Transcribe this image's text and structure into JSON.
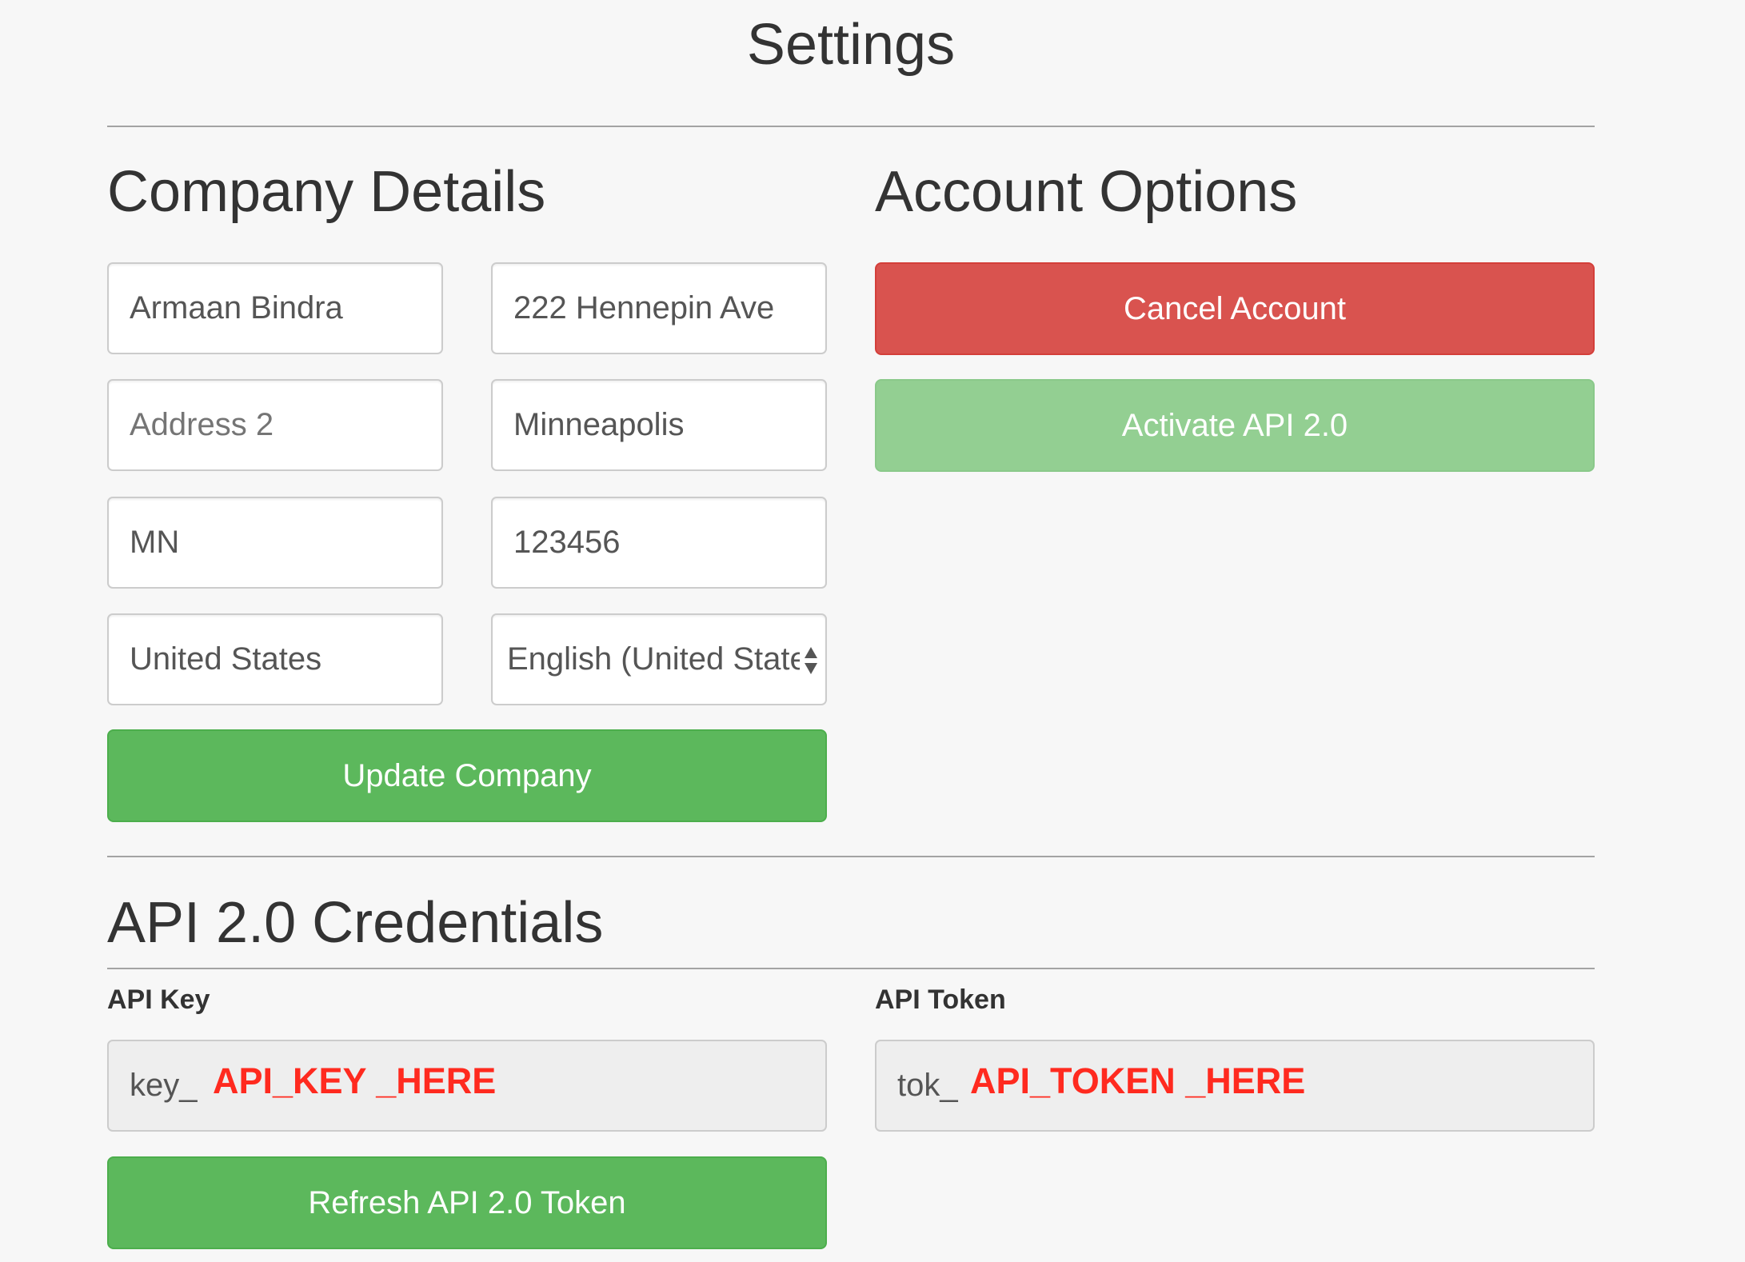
{
  "page": {
    "title": "Settings"
  },
  "company_details": {
    "title": "Company Details",
    "fields": [
      {
        "name": "company-name",
        "value": "Armaan Bindra",
        "placeholder": ""
      },
      {
        "name": "address-1",
        "value": "222 Hennepin Ave",
        "placeholder": ""
      },
      {
        "name": "address-2",
        "value": "",
        "placeholder": "Address 2"
      },
      {
        "name": "city",
        "value": "Minneapolis",
        "placeholder": ""
      },
      {
        "name": "state",
        "value": "MN",
        "placeholder": ""
      },
      {
        "name": "zip",
        "value": "123456",
        "placeholder": ""
      },
      {
        "name": "country",
        "value": "United States",
        "placeholder": ""
      }
    ],
    "language_select": {
      "selected": "English (United States)",
      "arrows_icon": "select-arrows-icon"
    },
    "update_button": "Update Company"
  },
  "account_options": {
    "title": "Account Options",
    "cancel_button": "Cancel Account",
    "activate_button": "Activate API 2.0"
  },
  "api_credentials": {
    "title": "API 2.0 Credentials",
    "key_label": "API Key",
    "key_prefix": "key_",
    "key_overlay": "API_KEY _HERE",
    "token_label": "API Token",
    "token_prefix": "tok_",
    "token_overlay": "API_TOKEN _HERE",
    "refresh_button": "Refresh API 2.0 Token"
  },
  "colors": {
    "success": "#5cb85c",
    "danger": "#d9534f",
    "disabled_success": "#93cf92",
    "redaction": "#ff2a1f"
  }
}
